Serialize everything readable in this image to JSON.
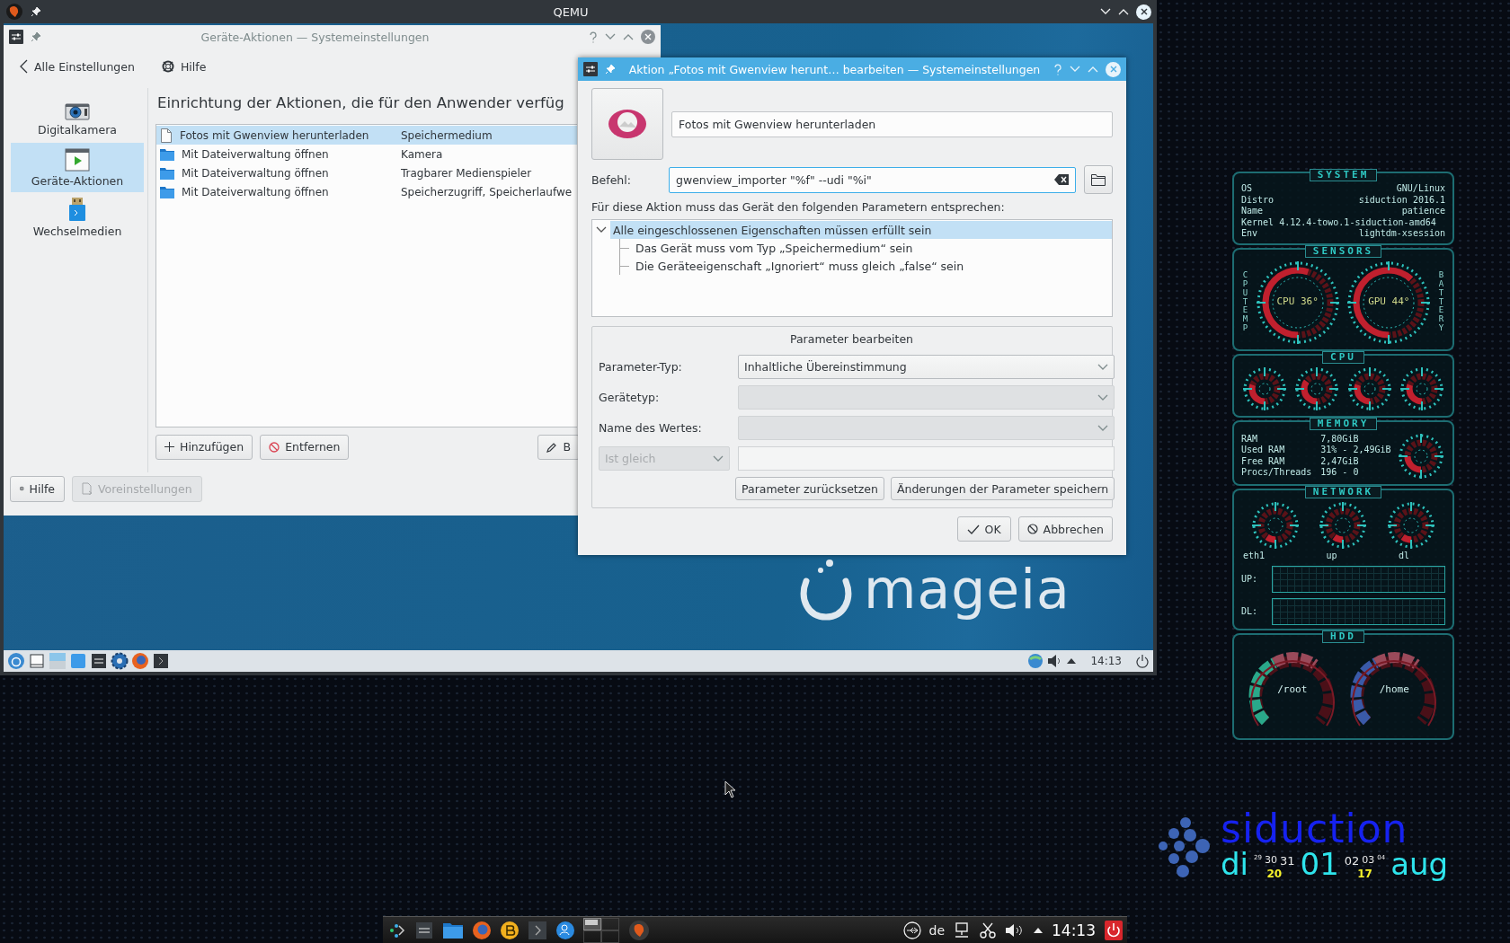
{
  "qemu_window": {
    "title": "QEMU"
  },
  "settings_window": {
    "title": "Geräte-Aktionen — Systemeinstellungen",
    "back_button": "Alle Einstellungen",
    "help_button": "Hilfe",
    "sidebar": [
      {
        "label": "Digitalkamera",
        "selected": false
      },
      {
        "label": "Geräte-Aktionen",
        "selected": true
      },
      {
        "label": "Wechselmedien",
        "selected": false
      }
    ],
    "heading": "Einrichtung der Aktionen, die für den Anwender verfüg",
    "actions": [
      {
        "name": "Fotos mit Gwenview herunterladen",
        "device": "Speichermedium",
        "selected": true
      },
      {
        "name": "Mit Dateiverwaltung öffnen",
        "device": "Kamera",
        "selected": false
      },
      {
        "name": "Mit Dateiverwaltung öffnen",
        "device": "Tragbarer Medienspieler",
        "selected": false
      },
      {
        "name": "Mit Dateiverwaltung öffnen",
        "device": "Speicherzugriff, Speicherlaufwe",
        "selected": false
      }
    ],
    "list_buttons": [
      {
        "kind": "add",
        "label": "Hinzufügen"
      },
      {
        "kind": "remove",
        "label": "Entfernen"
      },
      {
        "kind": "edit",
        "label": "B"
      }
    ],
    "footer_buttons": [
      {
        "kind": "help",
        "label": "Hilfe",
        "disabled": false
      },
      {
        "kind": "defaults",
        "label": "Voreinstellungen",
        "disabled": true
      }
    ]
  },
  "edit_dialog": {
    "title": "Aktion „Fotos mit Gwenview herunt… bearbeiten — Systemeinstellungen",
    "name_value": "Fotos mit Gwenview herunterladen",
    "command_label": "Befehl:",
    "command_value": "gwenview_importer \"%f\" --udi \"%i\"",
    "description": "Für diese Aktion muss das Gerät den folgenden Parametern entsprechen:",
    "tree": [
      {
        "label": "Alle eingeschlossenen Eigenschaften müssen erfüllt sein",
        "expanded": true,
        "selected": true,
        "children": [
          {
            "label": "Das Gerät muss vom Typ „Speichermedium“ sein",
            "selected": false
          },
          {
            "label": "Die Geräteeigenschaft „Ignoriert“ muss gleich „false“ sein",
            "selected": false
          }
        ]
      }
    ],
    "parameter_group": {
      "title": "Parameter bearbeiten",
      "fields": [
        {
          "label": "Parameter-Typ:",
          "value": "Inhaltliche Übereinstimmung",
          "disabled": false
        },
        {
          "label": "Gerätetyp:",
          "disabled": true
        },
        {
          "label": "Name des Wertes:",
          "disabled": true
        }
      ],
      "comparison": {
        "value": "Ist gleich",
        "disabled": true
      },
      "buttons": [
        "Parameter zurücksetzen",
        "Änderungen der Parameter speichern"
      ]
    },
    "ok_button": "OK",
    "cancel_button": "Abbrechen"
  },
  "wallpaper": {
    "logo": "mageia"
  },
  "guest_taskbar": {
    "clock": "14:13"
  },
  "conky": {
    "sections": [
      {
        "title": "SYSTEM",
        "kind": "info",
        "rows": [
          {
            "label": "OS",
            "value": "GNU/Linux"
          },
          {
            "label": "Distro",
            "value": "siduction 2016.1"
          },
          {
            "label": "Name",
            "value": "patience"
          },
          {
            "label": "Kernel",
            "value": "4.12.4-towo.1-siduction-amd64"
          },
          {
            "label": "Env",
            "value": "lightdm-xsession"
          }
        ]
      },
      {
        "title": "SENSORS",
        "kind": "sensors",
        "left_label": "CPUTEMP",
        "right_label": "BATTERY",
        "readings": [
          "CPU 36°",
          "GPU 44°"
        ]
      },
      {
        "title": "CPU",
        "kind": "cores"
      },
      {
        "title": "MEMORY",
        "kind": "memory",
        "rows": [
          {
            "label": "RAM",
            "value": "7,80GiB"
          },
          {
            "label": "Used RAM",
            "value": "31% - 2,49GiB"
          },
          {
            "label": "Free RAM",
            "value": "2,47GiB"
          },
          {
            "label": "Procs/Threads",
            "value": "196 - 0"
          }
        ]
      },
      {
        "title": "NETWORK",
        "kind": "network",
        "labels": [
          "eth1",
          "up",
          "dl"
        ],
        "graphs": [
          "UP:",
          "DL:"
        ]
      },
      {
        "title": "HDD",
        "kind": "disks",
        "mounts": [
          "/root",
          "/home"
        ]
      }
    ]
  },
  "clock_widget": {
    "brand": "siduction",
    "weekday": "di",
    "days_before": [
      "29",
      "30",
      "31"
    ],
    "day": "01",
    "days_after": [
      "02",
      "03",
      "04"
    ],
    "year": [
      "20",
      "17"
    ],
    "month": "aug"
  },
  "host_taskbar": {
    "keyboard_layout": "de",
    "clock": "14:13"
  }
}
